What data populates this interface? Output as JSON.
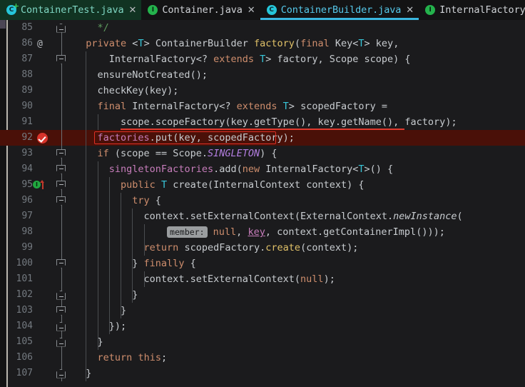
{
  "window": {
    "app": "IntelliJ IDEA code editor",
    "theme_bg": "#1b1b1d",
    "accent": "#3ab7e0",
    "highlight_bg": "#4a1008",
    "highlight_border": "#e03025"
  },
  "tabs": [
    {
      "label": "ContainerTest.java",
      "icon": "java-class-test-icon",
      "icon_kind": "cls",
      "badge": true,
      "active": false,
      "green_bg": true,
      "tinted": true,
      "close": "✕"
    },
    {
      "label": "Container.java",
      "icon": "java-interface-icon",
      "icon_kind": "iface",
      "badge": false,
      "active": false,
      "green_bg": false,
      "tinted": false,
      "close": "✕"
    },
    {
      "label": "ContainerBuilder.java",
      "icon": "java-class-icon",
      "icon_kind": "cls",
      "badge": false,
      "active": true,
      "green_bg": false,
      "tinted": false,
      "close": "✕"
    },
    {
      "label": "InternalFactory.java",
      "icon": "java-interface-icon",
      "icon_kind": "iface",
      "badge": false,
      "active": false,
      "green_bg": false,
      "tinted": false,
      "close": "✕"
    },
    {
      "label": "",
      "icon": "java-class-icon",
      "icon_kind": "cls",
      "badge": false,
      "active": false,
      "green_bg": false,
      "tinted": false,
      "close": ""
    }
  ],
  "editor": {
    "language": "Java",
    "first_line": 85,
    "last_line": 107,
    "highlighted_line": 92,
    "breakpoint_line": 92,
    "annotation_marker_line": 86,
    "implement_marker_line": 95,
    "parameter_hint": "member:",
    "lines": [
      {
        "n": "85",
        "text": "    */"
      },
      {
        "n": "86",
        "text": "  private <T> ContainerBuilder factory(final Key<T> key,"
      },
      {
        "n": "87",
        "text": "      InternalFactory<? extends T> factory, Scope scope) {"
      },
      {
        "n": "88",
        "text": "    ensureNotCreated();"
      },
      {
        "n": "89",
        "text": "    checkKey(key);"
      },
      {
        "n": "90",
        "text": "    final InternalFactory<? extends T> scopedFactory ="
      },
      {
        "n": "91",
        "text": "        scope.scopeFactory(key.getType(), key.getName(), factory);"
      },
      {
        "n": "92",
        "text": "    factories.put(key, scopedFactory);"
      },
      {
        "n": "93",
        "text": "    if (scope == Scope.SINGLETON) {"
      },
      {
        "n": "94",
        "text": "      singletonFactories.add(new InternalFactory<T>() {"
      },
      {
        "n": "95",
        "text": "        public T create(InternalContext context) {"
      },
      {
        "n": "96",
        "text": "          try {"
      },
      {
        "n": "97",
        "text": "            context.setExternalContext(ExternalContext.newInstance("
      },
      {
        "n": "98",
        "text": "                member: null, key, context.getContainerImpl()));"
      },
      {
        "n": "99",
        "text": "            return scopedFactory.create(context);"
      },
      {
        "n": "100",
        "text": "          } finally {"
      },
      {
        "n": "101",
        "text": "            context.setExternalContext(null);"
      },
      {
        "n": "102",
        "text": "          }"
      },
      {
        "n": "103",
        "text": "        }"
      },
      {
        "n": "104",
        "text": "      });"
      },
      {
        "n": "105",
        "text": "    }"
      },
      {
        "n": "106",
        "text": "    return this;"
      },
      {
        "n": "107",
        "text": "  }"
      }
    ]
  }
}
